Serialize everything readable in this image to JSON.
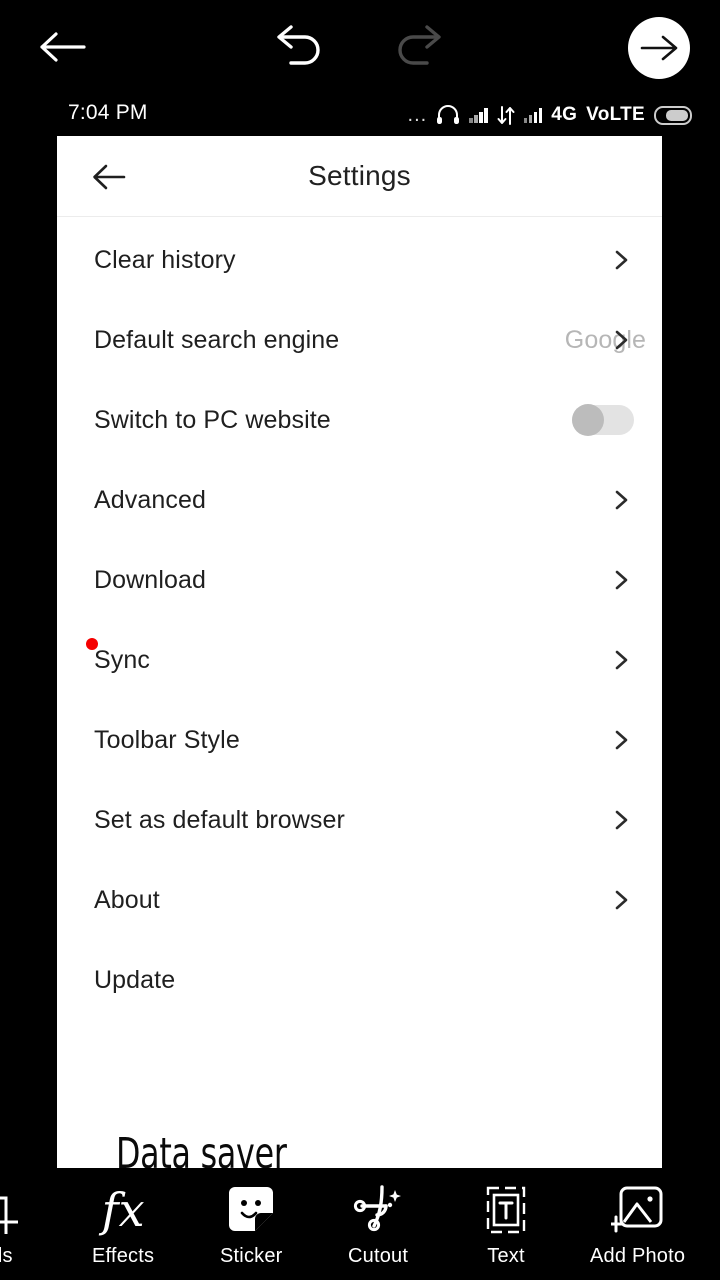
{
  "editor_topbar": {
    "back_icon": "arrow-left-icon",
    "undo_icon": "undo-icon",
    "redo_icon": "redo-icon",
    "next_icon": "arrow-right-icon"
  },
  "statusbar": {
    "time": "7:04 PM",
    "dots": "...",
    "headphone_icon": "headphones-icon",
    "signal_icon_1": "signal-bars-icon",
    "data_icon": "data-transfer-icon",
    "signal_icon_2": "signal-bars-icon",
    "network": "4G",
    "volte": "VoLTE",
    "battery_icon": "battery-icon"
  },
  "panel": {
    "header": {
      "back_icon": "arrow-left-icon",
      "title": "Settings"
    },
    "rows": [
      {
        "label": "Clear history",
        "value": "",
        "accessory": "chevron",
        "badge": false
      },
      {
        "label": "Default search engine",
        "value": "Google",
        "accessory": "chevron",
        "badge": false
      },
      {
        "label": "Switch to PC website",
        "value": "",
        "accessory": "toggle",
        "badge": false,
        "toggle_on": false
      },
      {
        "label": "Advanced",
        "value": "",
        "accessory": "chevron",
        "badge": false
      },
      {
        "label": "Download",
        "value": "",
        "accessory": "chevron",
        "badge": false
      },
      {
        "label": "Sync",
        "value": "",
        "accessory": "chevron",
        "badge": true
      },
      {
        "label": "Toolbar Style",
        "value": "",
        "accessory": "chevron",
        "badge": false
      },
      {
        "label": "Set as default browser",
        "value": "",
        "accessory": "chevron",
        "badge": false
      },
      {
        "label": "About",
        "value": "",
        "accessory": "chevron",
        "badge": false
      },
      {
        "label": "Update",
        "value": "",
        "accessory": "none",
        "badge": false
      }
    ]
  },
  "overlay": {
    "text": "Data saver"
  },
  "bottombar": {
    "tools": [
      {
        "label": "ools",
        "icon": "crop-icon"
      },
      {
        "label": "Effects",
        "icon": "fx-icon"
      },
      {
        "label": "Sticker",
        "icon": "sticker-icon"
      },
      {
        "label": "Cutout",
        "icon": "cutout-icon"
      },
      {
        "label": "Text",
        "icon": "text-icon"
      },
      {
        "label": "Add Photo",
        "icon": "add-photo-icon"
      }
    ]
  },
  "colors": {
    "background": "#000000",
    "panel": "#ffffff",
    "accent_badge": "#f50000",
    "muted_text": "#b6b6b6"
  }
}
